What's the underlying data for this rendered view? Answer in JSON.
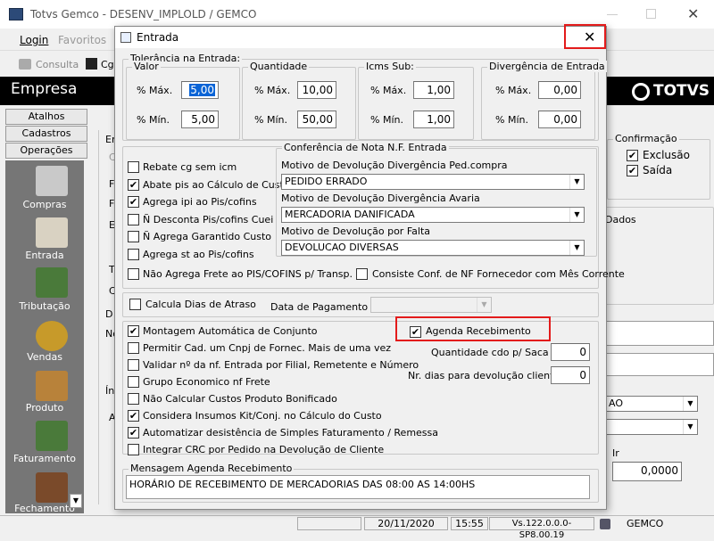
{
  "main_window": {
    "title": "Totvs Gemco - DESENV_IMPLOLD / GEMCO",
    "menu": [
      "Login",
      "Favoritos"
    ],
    "toolbar": {
      "consulta": "Consulta",
      "cg": "Cg"
    },
    "header_title": "Empresa",
    "logo_text": "TOTVS"
  },
  "sidebar": {
    "tabs": [
      "Atalhos",
      "Cadastros",
      "Operações"
    ],
    "items": [
      "Compras",
      "Entrada",
      "Tributação",
      "Vendas",
      "Produto",
      "Faturamento",
      "Fechamento"
    ]
  },
  "background_right": {
    "confirmacao_label": "Confirmação",
    "exclusao": "Exclusão",
    "saida": "Saída",
    "dados": "Dados",
    "combo_value": "AO",
    "ir_label": "Ir",
    "ir_value": "0,0000",
    "frag_letters": [
      "Er",
      "C",
      "F",
      "F",
      "E",
      "T",
      "C",
      "D",
      "No",
      "Ín",
      "A"
    ]
  },
  "dialog": {
    "title": "Entrada",
    "tolerancia": {
      "label": "Tolerância na Entrada:",
      "valor": {
        "label": "Valor",
        "max_label": "% Máx.",
        "max": "5,00",
        "min_label": "% Mín.",
        "min": "5,00"
      },
      "quantidade": {
        "label": "Quantidade",
        "max_label": "% Máx.",
        "max": "10,00",
        "min_label": "% Mín.",
        "min": "50,00"
      },
      "icms": {
        "label": "Icms Sub:",
        "max_label": "% Máx.",
        "max": "1,00",
        "min_label": "% Mín.",
        "min": "1,00"
      },
      "divergencia": {
        "label": "Divergência de Entrada",
        "max_label": "% Máx.",
        "max": "0,00",
        "min_label": "% Mín.",
        "min": "0,00"
      }
    },
    "left_checks": [
      {
        "label": "Rebate cg sem icm",
        "checked": false
      },
      {
        "label": "Abate pis ao Cálculo de Custo",
        "checked": true
      },
      {
        "label": "Agrega ipi ao Pis/cofins",
        "checked": true
      },
      {
        "label": "Ñ Desconta Pis/cofins Cuei",
        "checked": false
      },
      {
        "label": "Ñ Agrega Garantido Custo",
        "checked": false
      },
      {
        "label": "Agrega st ao Pis/cofins",
        "checked": false
      }
    ],
    "conferencia": {
      "label": "Conferência de Nota N.F. Entrada",
      "motivo1_label": "Motivo de Devolução Divergência Ped.compra",
      "motivo1_value": "PEDIDO ERRADO",
      "motivo2_label": "Motivo de Devolução Divergência Avaria",
      "motivo2_value": "MERCADORIA DANIFICADA",
      "motivo3_label": "Motivo de Devolução por Falta",
      "motivo3_value": "DEVOLUCAO DIVERSAS"
    },
    "nao_agrega_frete": "Não Agrega Frete ao PIS/COFINS p/ Transp. PF",
    "consiste_conf": "Consiste Conf. de NF Fornecedor com Mês Corrente",
    "calcula_dias": "Calcula Dias de Atraso",
    "data_pagamento": "Data de Pagamento",
    "checks2": [
      {
        "label": "Montagem Automática de Conjunto",
        "checked": true
      },
      {
        "label": "Permitir Cad. um Cnpj de Fornec. Mais de uma vez",
        "checked": false
      },
      {
        "label": "Validar nº da nf. Entrada por Filial, Remetente e Número",
        "checked": false
      },
      {
        "label": "Grupo Economico nf Frete",
        "checked": false
      },
      {
        "label": "Não Calcular Custos Produto Bonificado",
        "checked": false
      },
      {
        "label": "Considera Insumos Kit/Conj. no Cálculo do Custo",
        "checked": true
      },
      {
        "label": "Automatizar desistência de Simples Faturamento / Remessa",
        "checked": true
      },
      {
        "label": "Integrar CRC por Pedido na Devolução de Cliente",
        "checked": false
      }
    ],
    "agenda_recebimento": "Agenda Recebimento",
    "qtd_cdo_label": "Quantidade cdo p/ Saca",
    "qtd_cdo_value": "0",
    "nr_dias_label": "Nr. dias para devolução cliente",
    "nr_dias_value": "0",
    "mensagem_label": "Mensagem Agenda Recebimento",
    "mensagem_value": "HORÁRIO DE RECEBIMENTO DE MERCADORIAS DAS 08:00 AS 14:00HS"
  },
  "status_bar": {
    "date": "20/11/2020",
    "time": "15:55",
    "version": "Vs.122.0.0.0-SP8.00.19",
    "app": "GEMCO"
  }
}
